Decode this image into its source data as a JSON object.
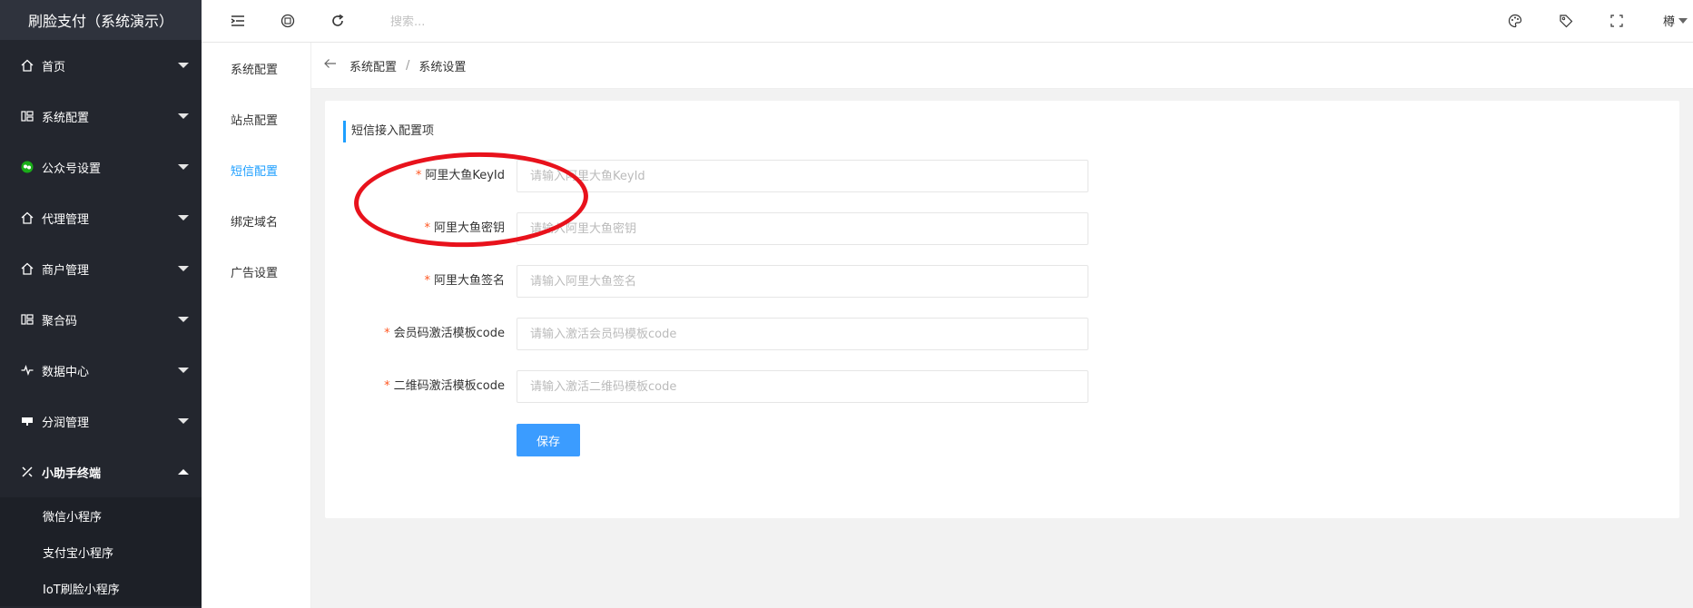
{
  "app": {
    "title": "刷脸支付（系统演示）"
  },
  "sidebar": {
    "items": [
      {
        "label": "首页",
        "icon": "home-icon"
      },
      {
        "label": "系统配置",
        "icon": "settings-grid-icon"
      },
      {
        "label": "公众号设置",
        "icon": "wechat-icon"
      },
      {
        "label": "代理管理",
        "icon": "home-icon"
      },
      {
        "label": "商户管理",
        "icon": "home-icon"
      },
      {
        "label": "聚合码",
        "icon": "settings-grid-icon"
      },
      {
        "label": "数据中心",
        "icon": "pulse-icon"
      },
      {
        "label": "分润管理",
        "icon": "monitor-icon"
      },
      {
        "label": "小助手终端",
        "icon": "tools-icon"
      }
    ],
    "sub_items": [
      {
        "label": "微信小程序"
      },
      {
        "label": "支付宝小程序"
      },
      {
        "label": "IoT刷脸小程序"
      }
    ]
  },
  "header": {
    "search_placeholder": "搜索...",
    "user_name": "樽"
  },
  "sub_sidebar": {
    "items": [
      {
        "label": "系统配置"
      },
      {
        "label": "站点配置"
      },
      {
        "label": "短信配置"
      },
      {
        "label": "绑定域名"
      },
      {
        "label": "广告设置"
      }
    ]
  },
  "breadcrumb": {
    "first": "系统配置",
    "separator": "/",
    "second": "系统设置"
  },
  "form": {
    "section_title": "短信接入配置项",
    "fields": [
      {
        "label": "阿里大鱼KeyId",
        "placeholder": "请输入阿里大鱼KeyId",
        "value": ""
      },
      {
        "label": "阿里大鱼密钥",
        "placeholder": "请输入阿里大鱼密钥",
        "value": ""
      },
      {
        "label": "阿里大鱼签名",
        "placeholder": "请输入阿里大鱼签名",
        "value": ""
      },
      {
        "label": "会员码激活模板code",
        "placeholder": "请输入激活会员码模板code",
        "value": ""
      },
      {
        "label": "二维码激活模板code",
        "placeholder": "请输入激活二维码模板code",
        "value": ""
      }
    ],
    "required_mark": "*",
    "save_label": "保存"
  },
  "colors": {
    "sidebar_bg": "#23262e",
    "accent": "#1e9fff",
    "save_button": "#3b9cff",
    "annotation": "#e8121c"
  }
}
